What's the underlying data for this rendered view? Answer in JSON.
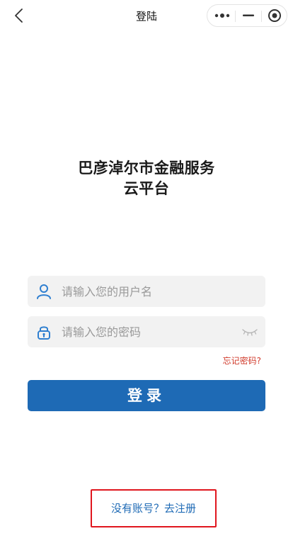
{
  "nav": {
    "title": "登陆",
    "back_icon": "chevron-left-icon",
    "more_icon": "more-dots-icon",
    "minimize_icon": "minimize-icon",
    "close_icon": "target-circle-icon"
  },
  "app": {
    "title_line1": "巴彦淖尔市金融服务",
    "title_line2": "云平台"
  },
  "form": {
    "username": {
      "icon": "user-icon",
      "placeholder": "请输入您的用户名",
      "value": ""
    },
    "password": {
      "icon": "lock-icon",
      "placeholder": "请输入您的密码",
      "value": "",
      "toggle_icon": "eye-closed-icon"
    },
    "forgot_label": "忘记密码?",
    "login_label": "登录"
  },
  "register": {
    "label": "没有账号？去注册"
  },
  "colors": {
    "accent": "#1e6ab5",
    "icon_blue": "#2f7fd0",
    "warning": "#d03a2b",
    "highlight_border": "#e0161e",
    "field_bg": "#f2f2f2"
  }
}
